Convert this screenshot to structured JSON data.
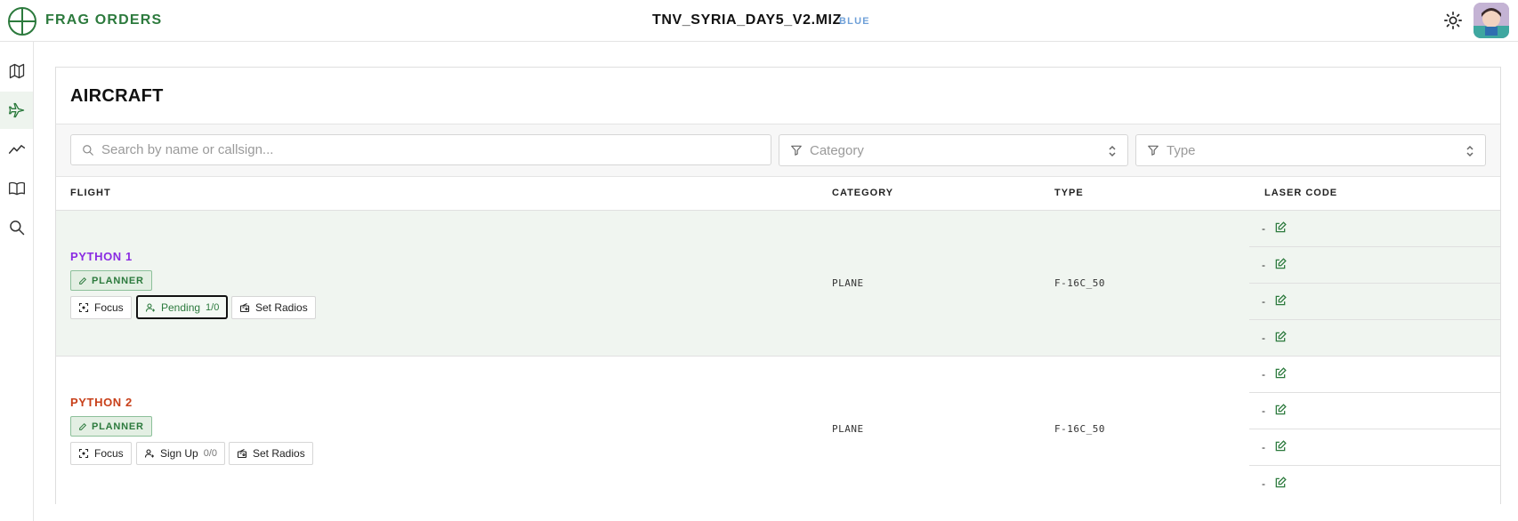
{
  "header": {
    "brand": "FRAG ORDERS",
    "mission": "TNV_SYRIA_DAY5_V2.MIZ",
    "coalition": "BLUE"
  },
  "sidebar": {
    "items": [
      {
        "icon": "map-icon"
      },
      {
        "icon": "plane-icon",
        "active": true
      },
      {
        "icon": "activity-icon"
      },
      {
        "icon": "book-icon"
      },
      {
        "icon": "search-icon"
      }
    ]
  },
  "main": {
    "title": "AIRCRAFT",
    "search_placeholder": "Search by name or callsign...",
    "category_placeholder": "Category",
    "type_placeholder": "Type",
    "columns": [
      "FLIGHT",
      "CATEGORY",
      "TYPE",
      "LASER CODE"
    ],
    "rows": [
      {
        "name": "PYTHON 1",
        "name_color": "#8a2be2",
        "badge": "PLANNER",
        "focus": "Focus",
        "signup": "Pending",
        "signup_count": "1/0",
        "radios": "Set Radios",
        "category": "PLANE",
        "type": "F-16C_50",
        "laser": [
          "-",
          "-",
          "-",
          "-"
        ]
      },
      {
        "name": "PYTHON 2",
        "name_color": "#c8401a",
        "badge": "PLANNER",
        "focus": "Focus",
        "signup": "Sign Up",
        "signup_count": "0/0",
        "radios": "Set Radios",
        "category": "PLANE",
        "type": "F-16C_50",
        "laser": [
          "-",
          "-",
          "-",
          "-"
        ]
      }
    ]
  },
  "colors": {
    "accent": "#2c7a3d",
    "coalition": "#6fa0d8",
    "row_highlight": "#f0f5f0"
  }
}
